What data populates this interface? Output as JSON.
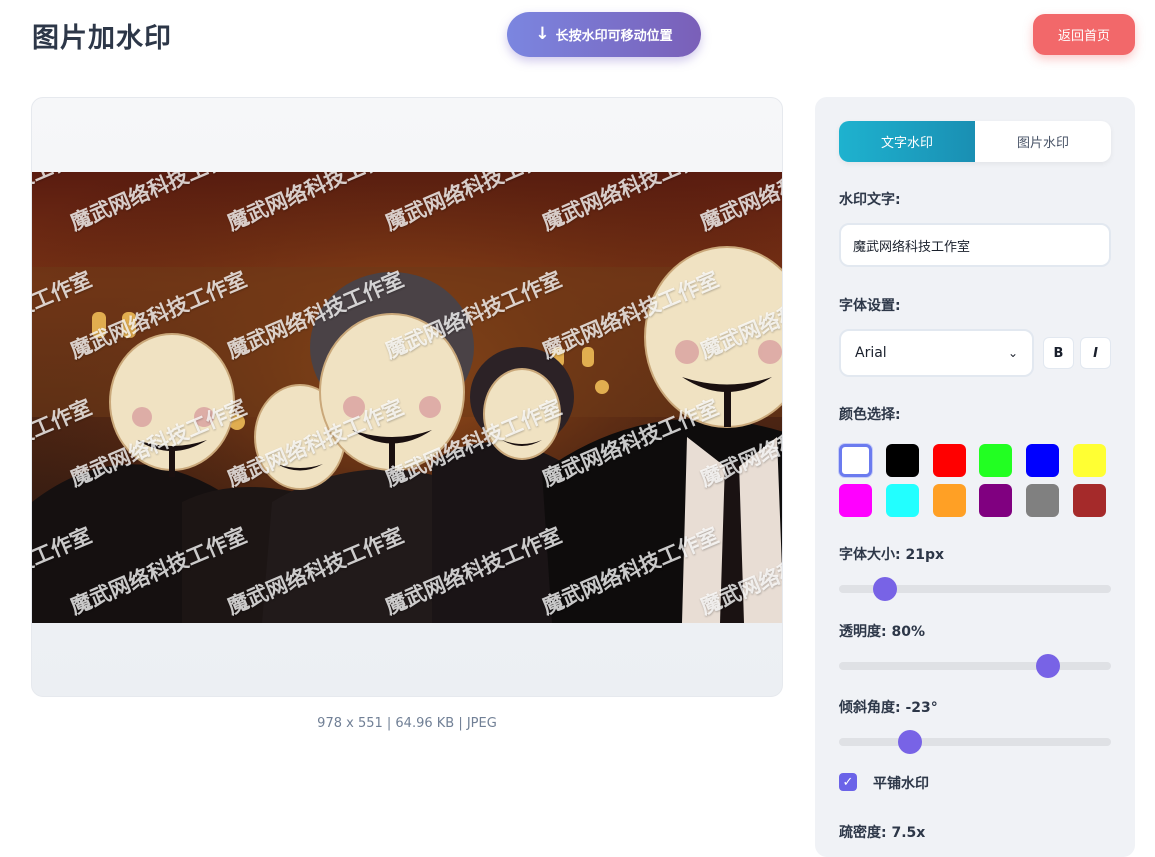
{
  "header": {
    "title": "图片加水印",
    "hint_label": "长按水印可移动位置",
    "hint_icon": "arrow-down-icon",
    "home_label": "返回首页"
  },
  "preview": {
    "watermark_text": "魔武网络科技工作室",
    "image_info": "978 x 551 | 64.96 KB | JPEG"
  },
  "settings": {
    "tabs": [
      {
        "label": "文字水印",
        "active": true
      },
      {
        "label": "图片水印",
        "active": false
      }
    ],
    "text_label": "水印文字:",
    "text_value": "魔武网络科技工作室",
    "font_label": "字体设置:",
    "font_value": "Arial",
    "bold_label": "B",
    "italic_label": "I",
    "color_label": "颜色选择:",
    "colors": [
      "#ffffff",
      "#000000",
      "#ff0000",
      "#22ff22",
      "#0000ff",
      "#ffff33",
      "#ff00ff",
      "#22ffff",
      "#ffa025",
      "#800080",
      "#808080",
      "#a52a2a"
    ],
    "selected_color": "#ffffff",
    "size_label": "字体大小: 21px",
    "size_fraction": 0.17,
    "opacity_label": "透明度: 80%",
    "opacity_fraction": 0.77,
    "angle_label": "倾斜角度: -23°",
    "angle_fraction": 0.26,
    "tile_label": "平铺水印",
    "tile_checked": true,
    "density_label": "疏密度: 7.5x"
  }
}
